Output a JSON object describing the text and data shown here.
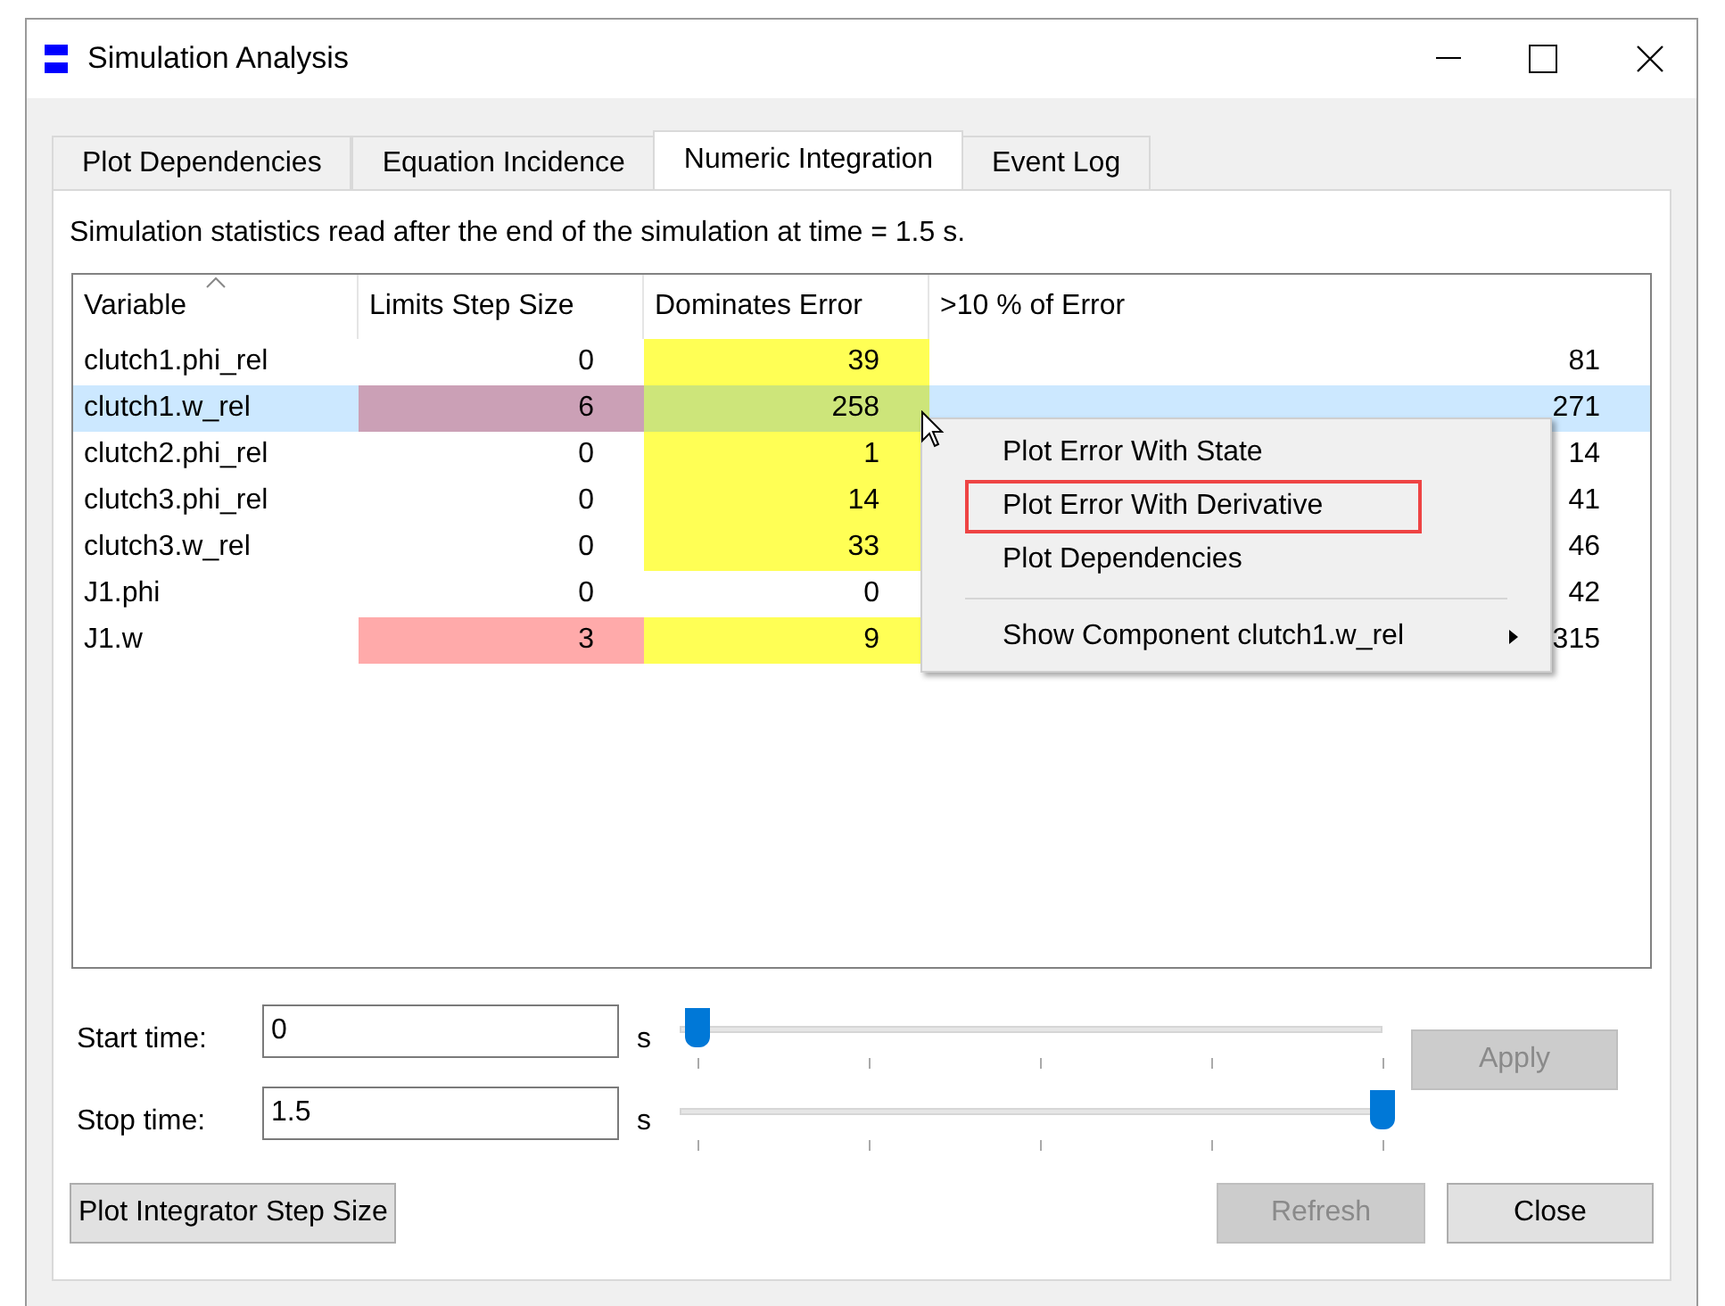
{
  "window": {
    "title": "Simulation Analysis"
  },
  "tabs": [
    {
      "label": "Plot Dependencies",
      "selected": false
    },
    {
      "label": "Equation Incidence",
      "selected": false
    },
    {
      "label": "Numeric Integration",
      "selected": true
    },
    {
      "label": "Event Log",
      "selected": false
    }
  ],
  "info": "Simulation statistics read after the end of the simulation at time = 1.5 s.",
  "table": {
    "columns": [
      "Variable",
      "Limits Step Size",
      "Dominates Error",
      ">10 % of Error"
    ],
    "rows": [
      {
        "selected": false,
        "cells": [
          {
            "text": "clutch1.phi_rel"
          },
          {
            "text": "0"
          },
          {
            "text": "39",
            "color": "#ffff55"
          },
          {
            "text": "81"
          }
        ]
      },
      {
        "selected": true,
        "cells": [
          {
            "text": "clutch1.w_rel"
          },
          {
            "text": "6",
            "color": "#cba0b6"
          },
          {
            "text": "258",
            "color": "#cde57a"
          },
          {
            "text": "271"
          }
        ]
      },
      {
        "selected": false,
        "cells": [
          {
            "text": "clutch2.phi_rel"
          },
          {
            "text": "0"
          },
          {
            "text": "1",
            "color": "#ffff55"
          },
          {
            "text": "14"
          }
        ]
      },
      {
        "selected": false,
        "cells": [
          {
            "text": "clutch3.phi_rel"
          },
          {
            "text": "0"
          },
          {
            "text": "14",
            "color": "#ffff55"
          },
          {
            "text": "41"
          }
        ]
      },
      {
        "selected": false,
        "cells": [
          {
            "text": "clutch3.w_rel"
          },
          {
            "text": "0"
          },
          {
            "text": "33",
            "color": "#ffff55"
          },
          {
            "text": "46"
          }
        ]
      },
      {
        "selected": false,
        "cells": [
          {
            "text": "J1.phi"
          },
          {
            "text": "0"
          },
          {
            "text": "0"
          },
          {
            "text": "42"
          }
        ]
      },
      {
        "selected": false,
        "cells": [
          {
            "text": "J1.w"
          },
          {
            "text": "3",
            "color": "#ffaaaa"
          },
          {
            "text": "9",
            "color": "#ffff55"
          },
          {
            "text": "315"
          }
        ]
      }
    ]
  },
  "context_menu": [
    {
      "kind": "item",
      "label": "Plot Error With State",
      "highlighted": false
    },
    {
      "kind": "item",
      "label": "Plot Error With Derivative",
      "highlighted": true
    },
    {
      "kind": "item",
      "label": "Plot Dependencies",
      "highlighted": false
    },
    {
      "kind": "separator"
    },
    {
      "kind": "submenu",
      "label": "Show Component clutch1.w_rel",
      "highlighted": false
    }
  ],
  "time_controls": [
    {
      "label": "Start time:",
      "value": "0",
      "unit": "s",
      "level": 0
    },
    {
      "label": "Stop time:",
      "value": "1.5",
      "unit": "s",
      "level": 1
    }
  ],
  "apply_button": {
    "label": "Apply",
    "disabled": true
  },
  "buttons": [
    {
      "label": "Plot Integrator Step Size",
      "disabled": false
    },
    {
      "label": "Refresh",
      "disabled": true
    },
    {
      "label": "Close",
      "disabled": false
    }
  ]
}
